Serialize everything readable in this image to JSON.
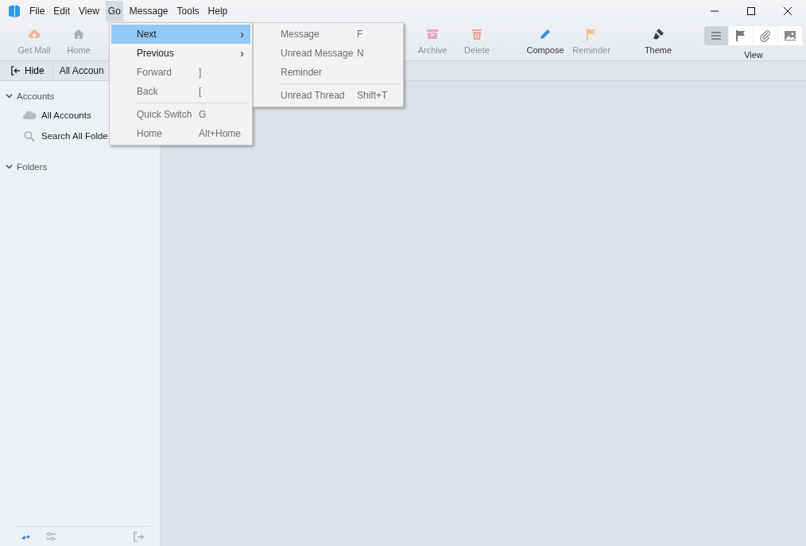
{
  "menubar": [
    {
      "label": "File",
      "selected": false
    },
    {
      "label": "Edit",
      "selected": false
    },
    {
      "label": "View",
      "selected": false
    },
    {
      "label": "Go",
      "selected": true
    },
    {
      "label": "Message",
      "selected": false
    },
    {
      "label": "Tools",
      "selected": false
    },
    {
      "label": "Help",
      "selected": false
    }
  ],
  "toolbar": {
    "left": [
      {
        "label": "Get Mail",
        "disabled": true
      },
      {
        "label": "Home",
        "disabled": true
      }
    ],
    "middle": [
      {
        "label": "Archive",
        "disabled": true
      },
      {
        "label": "Delete",
        "disabled": true
      },
      {
        "label": "Compose",
        "disabled": false
      },
      {
        "label": "Reminder",
        "disabled": true
      },
      {
        "label": "Theme",
        "disabled": false
      }
    ],
    "view": {
      "label": "View",
      "buttons": [
        {
          "selected": true
        },
        {
          "selected": false
        },
        {
          "selected": false
        },
        {
          "selected": false
        }
      ]
    }
  },
  "subbar": {
    "hide": "Hide",
    "accounts": "All Accoun"
  },
  "sidebar": {
    "sections": [
      {
        "label": "Accounts",
        "expanded": true,
        "items": [
          "All Accounts",
          "Search All Folde"
        ]
      },
      {
        "label": "Folders",
        "expanded": true
      }
    ]
  },
  "go_menu": {
    "items": [
      {
        "kind": "submenu",
        "label": "Next",
        "arrow": "›",
        "selected": true,
        "disabled": false
      },
      {
        "kind": "submenu",
        "label": "Previous",
        "arrow": "›",
        "selected": false,
        "disabled": false
      },
      {
        "kind": "item",
        "label": "Forward",
        "shortcut": "]",
        "selected": false,
        "disabled": true
      },
      {
        "kind": "item",
        "label": "Back",
        "shortcut": "[",
        "selected": false,
        "disabled": true
      },
      {
        "kind": "separator"
      },
      {
        "kind": "item",
        "label": "Quick Switch",
        "shortcut": "G",
        "selected": false,
        "disabled": true
      },
      {
        "kind": "item",
        "label": "Home",
        "shortcut": "Alt+Home",
        "selected": false,
        "disabled": true
      }
    ]
  },
  "next_submenu": {
    "items": [
      {
        "kind": "item",
        "label": "Message",
        "shortcut": "F",
        "selected": false,
        "disabled": true
      },
      {
        "kind": "item",
        "label": "Unread Message",
        "shortcut": "N",
        "selected": false,
        "disabled": true
      },
      {
        "kind": "item",
        "label": "Reminder",
        "selected": false,
        "disabled": true
      },
      {
        "kind": "separator"
      },
      {
        "kind": "item",
        "label": "Unread Thread",
        "shortcut": "Shift+T",
        "selected": false,
        "disabled": true
      }
    ]
  }
}
